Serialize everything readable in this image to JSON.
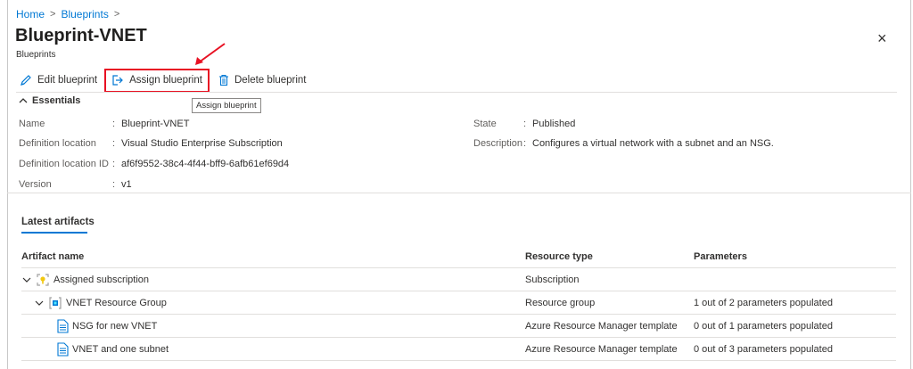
{
  "breadcrumb": {
    "items": [
      "Home",
      "Blueprints"
    ],
    "separator": ">"
  },
  "header": {
    "title": "Blueprint-VNET",
    "subtitle": "Blueprints",
    "close_icon": "×"
  },
  "toolbar": {
    "edit_label": "Edit blueprint",
    "assign_label": "Assign blueprint",
    "delete_label": "Delete blueprint",
    "tooltip": "Assign blueprint",
    "highlight_color": "#e81123"
  },
  "essentials": {
    "heading": "Essentials",
    "left": [
      {
        "label": "Name",
        "value": "Blueprint-VNET"
      },
      {
        "label": "Definition location",
        "value": "Visual Studio Enterprise Subscription"
      },
      {
        "label": "Definition location ID",
        "value": "af6f9552-38c4-4f44-bff9-6afb61ef69d4"
      },
      {
        "label": "Version",
        "value": "v1"
      }
    ],
    "right": [
      {
        "label": "State",
        "value": "Published"
      },
      {
        "label": "Description",
        "value": "Configures a virtual network with a subnet and an NSG."
      }
    ]
  },
  "artifacts": {
    "tab": "Latest artifacts",
    "columns": [
      "Artifact name",
      "Resource type",
      "Parameters"
    ],
    "rows": [
      {
        "name": "Assigned subscription",
        "type": "Subscription",
        "params": ""
      },
      {
        "name": "VNET Resource Group",
        "type": "Resource group",
        "params": "1 out of 2 parameters populated"
      },
      {
        "name": "NSG for new VNET",
        "type": "Azure Resource Manager template",
        "params": "0 out of 1 parameters populated"
      },
      {
        "name": "VNET and one subnet",
        "type": "Azure Resource Manager template",
        "params": "0 out of 3 parameters populated"
      }
    ]
  },
  "colors": {
    "link": "#0078d4",
    "accent": "#0078d4"
  }
}
